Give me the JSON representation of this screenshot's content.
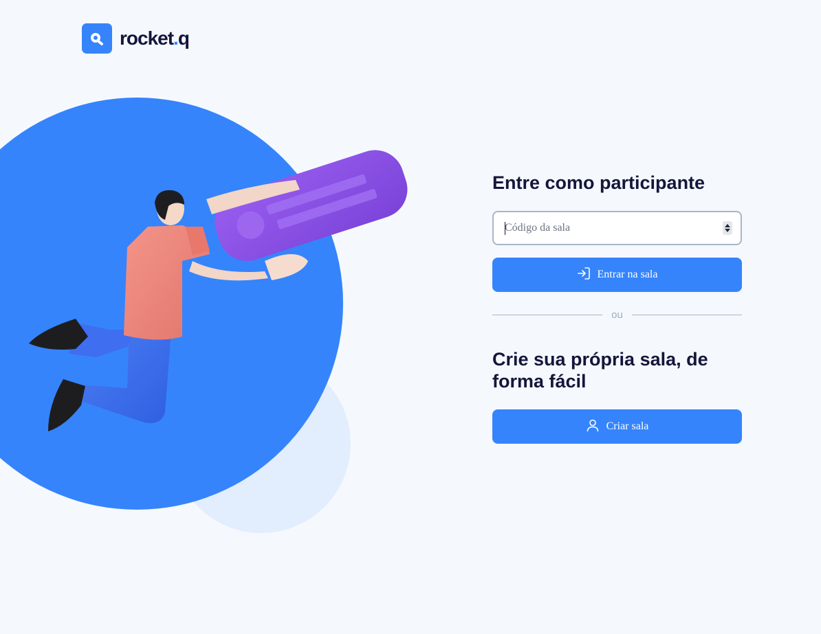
{
  "brand": {
    "name_main": "rocket",
    "name_dot": ".",
    "name_suffix": "q",
    "icon": "search-logo-icon",
    "color": "#3584fb"
  },
  "join": {
    "title": "Entre como participante",
    "room_code_placeholder": "Código da sala",
    "room_code_value": "",
    "enter_button_label": "Entrar na sala",
    "enter_button_icon": "log-in-icon"
  },
  "divider": {
    "label": "ou"
  },
  "create": {
    "title": "Crie sua própria sala, de forma fácil",
    "create_button_label": "Criar sala",
    "create_button_icon": "user-icon"
  },
  "colors": {
    "background": "#f5f9fe",
    "accent": "#3584fb",
    "heading": "#14163b",
    "card_purple": "#8a4fe0",
    "light_circle": "#e2edfd"
  }
}
